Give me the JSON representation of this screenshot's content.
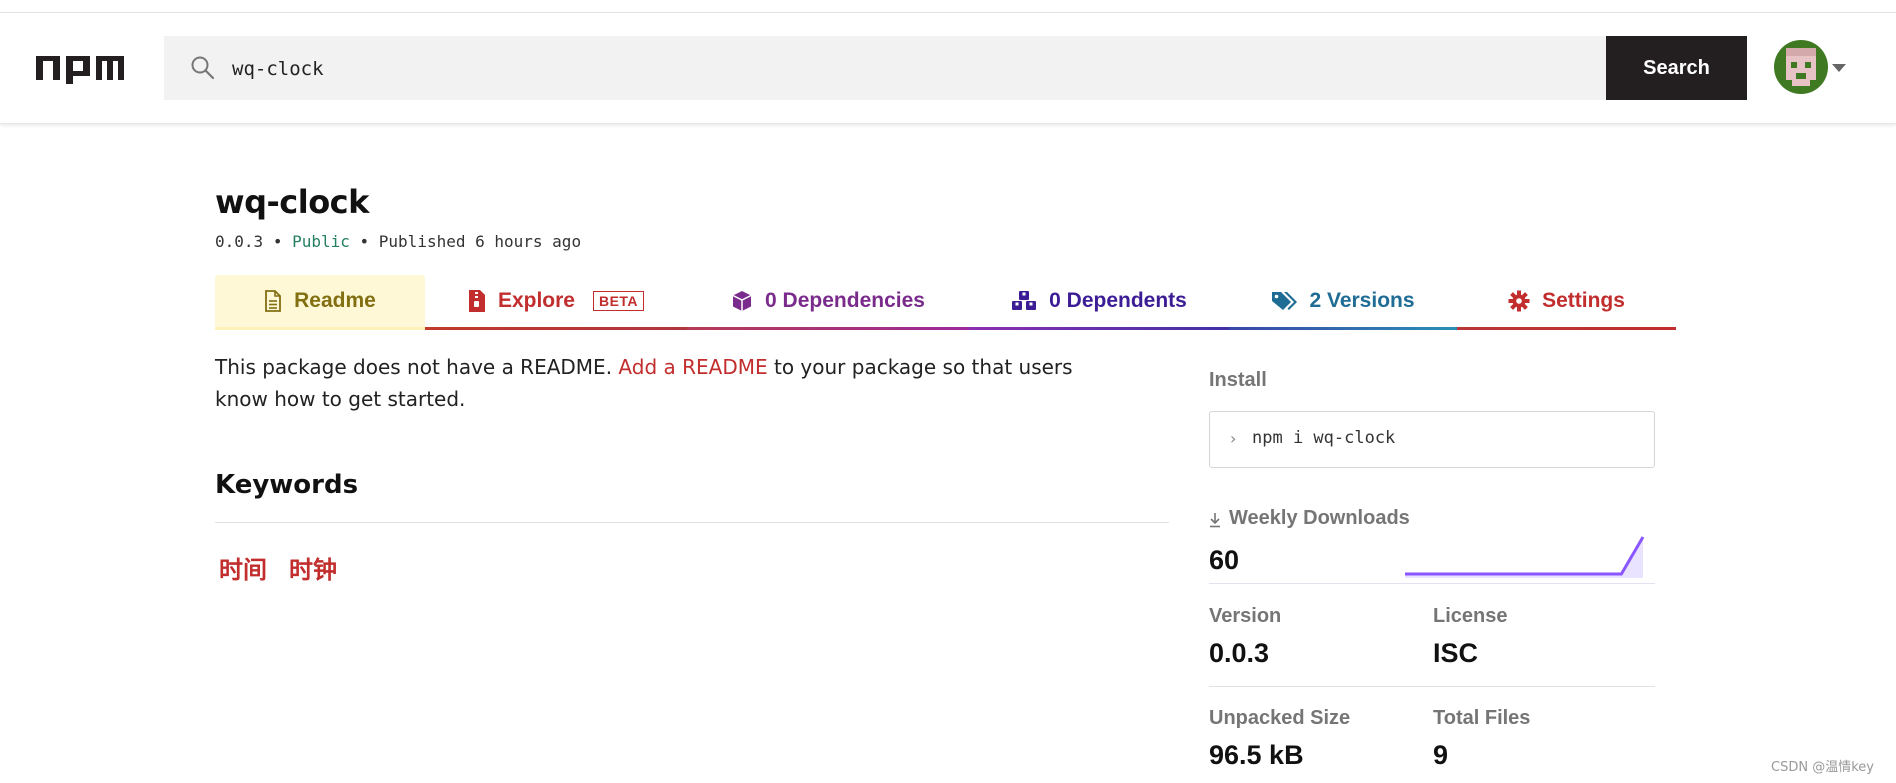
{
  "header": {
    "search_value": "wq-clock",
    "search_button": "Search"
  },
  "package": {
    "name": "wq-clock",
    "version": "0.0.3",
    "visibility": "Public",
    "published": "Published 6 hours ago"
  },
  "tabs": [
    {
      "label": "Readme",
      "color": "#826f12"
    },
    {
      "label": "Explore",
      "badge": "BETA",
      "color": "#c22d2d"
    },
    {
      "label": "0 Dependencies",
      "color": "#7a2c8c"
    },
    {
      "label": "0 Dependents",
      "color": "#3c1d96"
    },
    {
      "label": "2 Versions",
      "color": "#1f6c94"
    },
    {
      "label": "Settings",
      "color": "#c22d2d"
    }
  ],
  "readme": {
    "text_before": "This package does not have a README.",
    "link": "Add a README",
    "text_after": "to your package so that users know how to get started."
  },
  "keywords": {
    "heading": "Keywords",
    "items": [
      "时间",
      "时钟"
    ]
  },
  "sidebar": {
    "install_label": "Install",
    "install_prompt": "›",
    "install_command": "npm i wq-clock",
    "weekly_downloads_label": "Weekly Downloads",
    "weekly_downloads_value": "60",
    "version_label": "Version",
    "version_value": "0.0.3",
    "license_label": "License",
    "license_value": "ISC",
    "unpacked_size_label": "Unpacked Size",
    "unpacked_size_value": "96.5 kB",
    "total_files_label": "Total Files",
    "total_files_value": "9"
  },
  "sparkline": {
    "values": [
      0,
      0,
      0,
      0,
      0,
      0,
      0,
      0,
      0,
      0,
      0,
      60
    ],
    "color": "#8956ff"
  },
  "watermark": "CSDN @温情key",
  "icons": {
    "logo": "npm-logo",
    "search": "search-icon",
    "readme": "file-icon",
    "explore": "zip-file-icon",
    "dependencies": "box-icon",
    "dependents": "boxes-icon",
    "versions": "tags-icon",
    "settings": "gear-icon",
    "download": "download-icon"
  },
  "colors": {
    "accent": "#c22d2d",
    "search_button_bg": "#231f20",
    "public": "#258062"
  }
}
